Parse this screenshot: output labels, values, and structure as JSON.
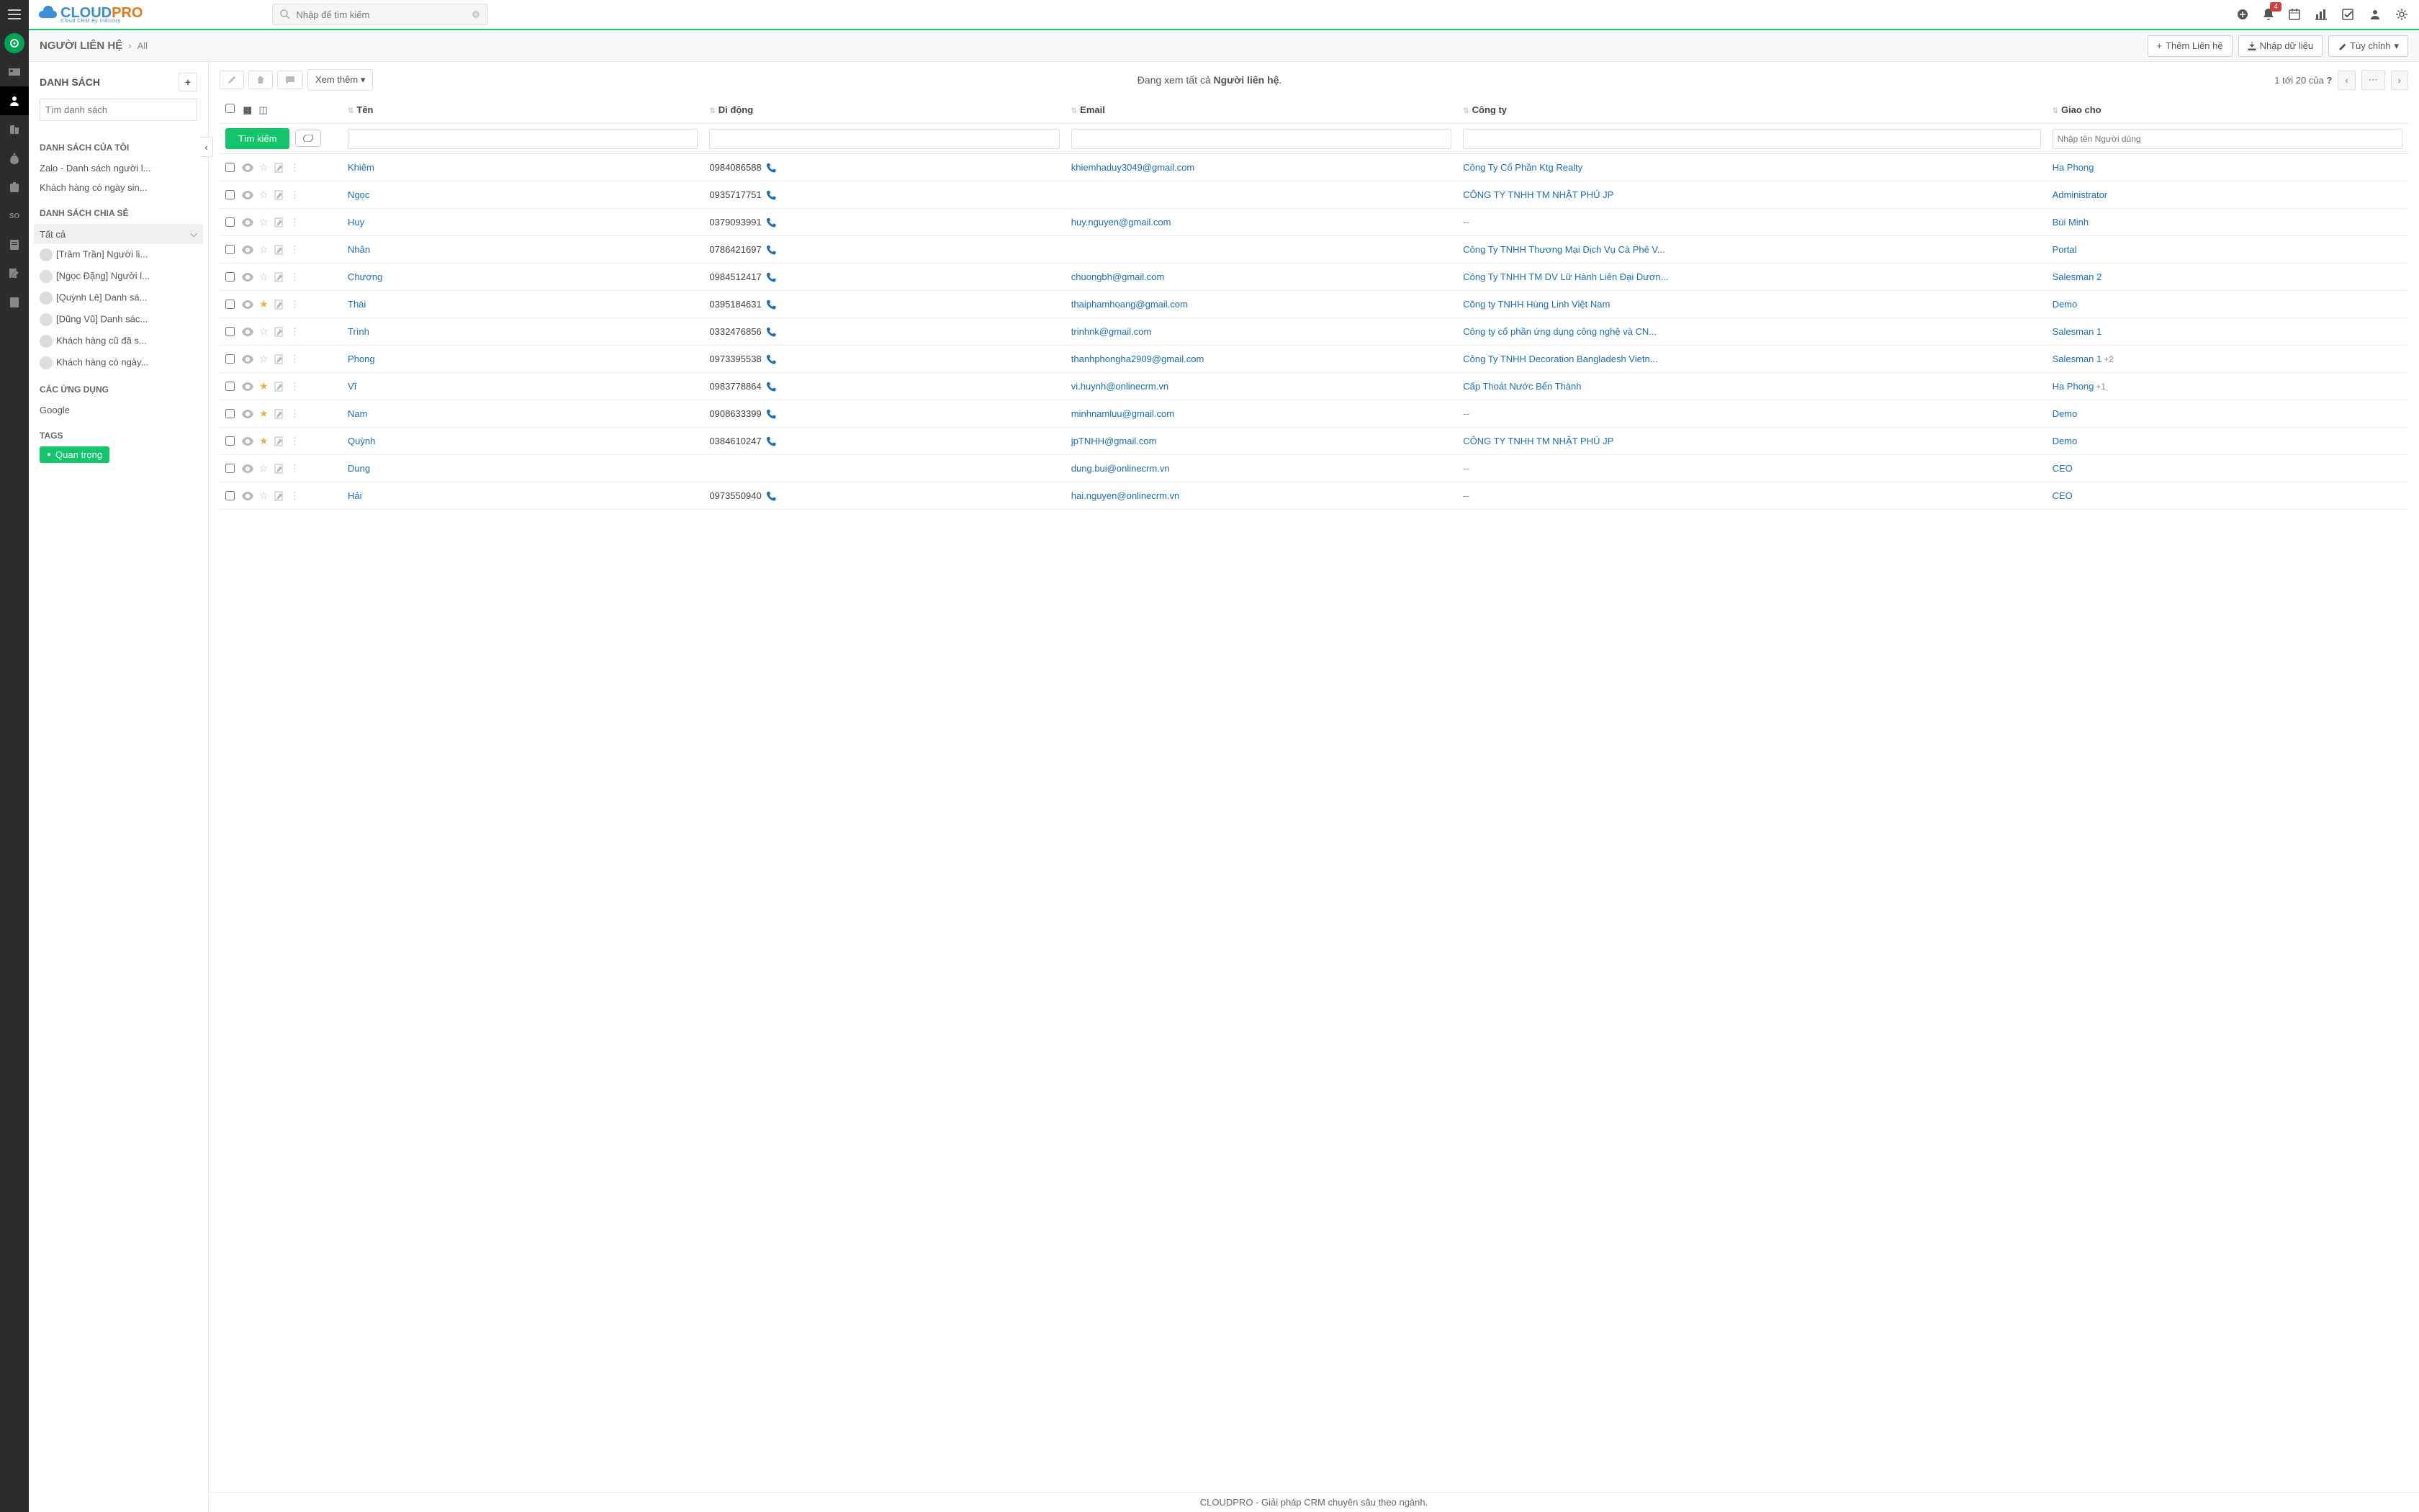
{
  "header": {
    "search_placeholder": "Nhập để tìm kiếm",
    "notification_count": "4"
  },
  "breadcrumb": {
    "title": "NGƯỜI LIÊN HỆ",
    "sub": "All",
    "add_button": "Thêm Liên hệ",
    "import_button": "Nhập dữ liệu",
    "customize_button": "Tùy chỉnh"
  },
  "left_panel": {
    "lists_title": "DANH SÁCH",
    "search_placeholder": "Tìm danh sách",
    "my_lists_title": "DANH SÁCH CỦA TÔI",
    "my_lists": [
      "Zalo - Danh sách người l...",
      "Khách hàng có ngày sin..."
    ],
    "shared_title": "DANH SÁCH CHIA SẺ",
    "all_label": "Tất cả",
    "shared_lists": [
      "[Trâm Trần] Người li...",
      "[Ngọc Đặng] Người l...",
      "[Quỳnh Lê] Danh sá...",
      "[Dũng Vũ] Danh sác...",
      "Khách hàng cũ đã s...",
      "Khách hàng có ngày..."
    ],
    "apps_title": "CÁC ỨNG DỤNG",
    "apps": [
      "Google"
    ],
    "tags_title": "TAGS",
    "tags": [
      "Quan trọng"
    ]
  },
  "toolbar": {
    "more_label": "Xem thêm",
    "viewing_prefix": "Đang xem tất cả ",
    "viewing_bold": "Người liên hệ",
    "page_info_1": "1 tới 20  của ",
    "page_info_2": "?"
  },
  "table": {
    "headers": {
      "name": "Tên",
      "mobile": "Di động",
      "email": "Email",
      "company": "Công ty",
      "assigned": "Giao cho"
    },
    "search_btn": "Tìm kiếm",
    "assigned_placeholder": "Nhập tên Người dùng",
    "rows": [
      {
        "name": "Khiêm",
        "mobile": "0984086588",
        "email": "khiemhaduy3049@gmail.com",
        "company": "Công Ty Cổ Phần Ktg Realty",
        "assigned": "Ha Phong",
        "star": false
      },
      {
        "name": "Ngọc",
        "mobile": "0935717751",
        "email": "",
        "company": "CÔNG TY TNHH TM NHẬT PHÚ JP",
        "assigned": "Administrator",
        "star": false
      },
      {
        "name": "Huy",
        "mobile": "0379093991",
        "email": "huy.nguyen@gmail.com",
        "company": "--",
        "assigned": "Bùi Minh",
        "star": false,
        "company_muted": true
      },
      {
        "name": "Nhân",
        "mobile": "0786421697",
        "email": "",
        "company": "Công Ty TNHH Thương Mại Dịch Vụ Cà Phê V...",
        "assigned": "Portal",
        "star": false
      },
      {
        "name": "Chương",
        "mobile": "0984512417",
        "email": "chuongbh@gmail.com",
        "company": "Công Ty TNHH TM DV Lữ Hành Liên Đại Dươn...",
        "assigned": "Salesman 2",
        "star": false
      },
      {
        "name": "Thái",
        "mobile": "0395184631",
        "email": "thaiphamhoang@gmail.com",
        "company": "Công ty TNHH Hùng Linh Việt Nam",
        "assigned": "Demo",
        "star": true
      },
      {
        "name": "Trình",
        "mobile": "0332476856",
        "email": "trinhnk@gmail.com",
        "company": "Công ty cổ phần ứng dụng công nghệ và CN...",
        "assigned": "Salesman 1",
        "star": false
      },
      {
        "name": "Phong",
        "mobile": "0973395538",
        "email": "thanhphongha2909@gmail.com",
        "company": "Công Ty TNHH Decoration Bangladesh Vietn...",
        "assigned": "Salesman 1",
        "assigned_extra": "+2",
        "star": false
      },
      {
        "name": "Vĩ",
        "mobile": "0983778864",
        "email": "vi.huynh@onlinecrm.vn",
        "company": "Cấp Thoát Nước Bến Thành",
        "assigned": "Ha Phong",
        "assigned_extra": "+1",
        "star": true
      },
      {
        "name": "Nam",
        "mobile": "0908633399",
        "email": "minhnamluu@gmail.com",
        "company": "--",
        "assigned": "Demo",
        "star": true,
        "company_muted": true
      },
      {
        "name": "Quỳnh",
        "mobile": "0384610247",
        "email": "jpTNHH@gmail.com",
        "company": "CÔNG TY TNHH TM NHẬT PHÚ JP",
        "assigned": "Demo",
        "star": true
      },
      {
        "name": "Dung",
        "mobile": "",
        "email": "dung.bui@onlinecrm.vn",
        "company": "--",
        "assigned": "CEO",
        "star": false,
        "company_muted": true
      },
      {
        "name": "Hải",
        "mobile": "0973550940",
        "email": "hai.nguyen@onlinecrm.vn",
        "company": "--",
        "assigned": "CEO",
        "star": false,
        "company_muted": true
      }
    ]
  },
  "footer": "CLOUDPRO - Giải pháp CRM chuyên sâu theo ngành."
}
